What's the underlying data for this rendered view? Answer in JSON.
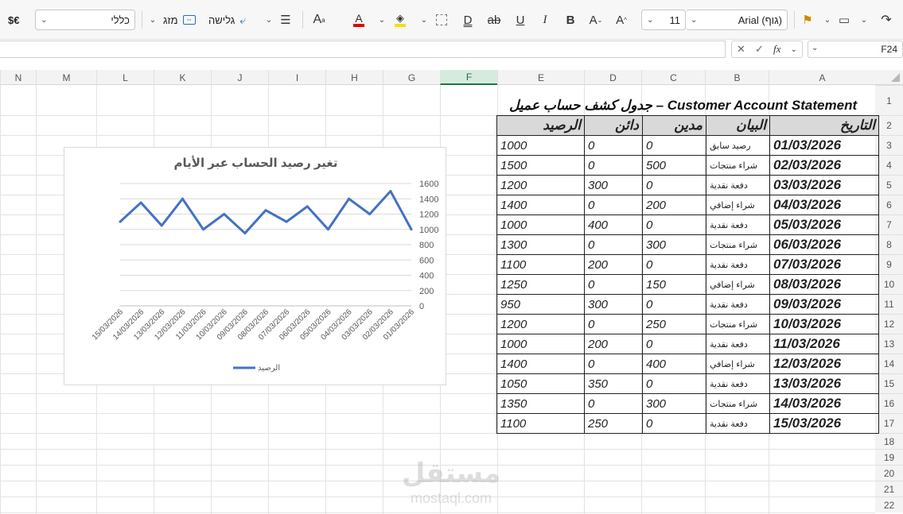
{
  "ribbon": {
    "currency_label": "$€",
    "number_format": "כללי",
    "merge_label": "מזג",
    "wrap_label": "גלישה",
    "font_size": "11",
    "font_name": "Arial (גוף)"
  },
  "formula_bar": {
    "name_box": "F24",
    "fx_label": "fx",
    "formula": ""
  },
  "columns": [
    "N",
    "M",
    "L",
    "K",
    "J",
    "I",
    "H",
    "G",
    "F",
    "E",
    "D",
    "C",
    "B",
    "A"
  ],
  "rows": [
    "1",
    "2",
    "3",
    "4",
    "5",
    "6",
    "7",
    "8",
    "9",
    "10",
    "11",
    "12",
    "13",
    "14",
    "15",
    "16",
    "17",
    "18",
    "19",
    "20",
    "21",
    "22"
  ],
  "sheet": {
    "title": "جدول كشف حساب عميل – Customer Account Statement",
    "headers": [
      "التاريخ",
      "البيان",
      "مدين",
      "دائن",
      "الرصيد"
    ],
    "rows": [
      {
        "date": "01/03/2026",
        "desc": "رصيد سابق",
        "debit": "0",
        "credit": "0",
        "balance": "1000"
      },
      {
        "date": "02/03/2026",
        "desc": "شراء منتجات",
        "debit": "500",
        "credit": "0",
        "balance": "1500"
      },
      {
        "date": "03/03/2026",
        "desc": "دفعة نقدية",
        "debit": "0",
        "credit": "300",
        "balance": "1200"
      },
      {
        "date": "04/03/2026",
        "desc": "شراء إضافي",
        "debit": "200",
        "credit": "0",
        "balance": "1400"
      },
      {
        "date": "05/03/2026",
        "desc": "دفعة نقدية",
        "debit": "0",
        "credit": "400",
        "balance": "1000"
      },
      {
        "date": "06/03/2026",
        "desc": "شراء منتجات",
        "debit": "300",
        "credit": "0",
        "balance": "1300"
      },
      {
        "date": "07/03/2026",
        "desc": "دفعة نقدية",
        "debit": "0",
        "credit": "200",
        "balance": "1100"
      },
      {
        "date": "08/03/2026",
        "desc": "شراء إضافي",
        "debit": "150",
        "credit": "0",
        "balance": "1250"
      },
      {
        "date": "09/03/2026",
        "desc": "دفعة نقدية",
        "debit": "0",
        "credit": "300",
        "balance": "950"
      },
      {
        "date": "10/03/2026",
        "desc": "شراء منتجات",
        "debit": "250",
        "credit": "0",
        "balance": "1200"
      },
      {
        "date": "11/03/2026",
        "desc": "دفعة نقدية",
        "debit": "0",
        "credit": "200",
        "balance": "1000"
      },
      {
        "date": "12/03/2026",
        "desc": "شراء إضافي",
        "debit": "400",
        "credit": "0",
        "balance": "1400"
      },
      {
        "date": "13/03/2026",
        "desc": "دفعة نقدية",
        "debit": "0",
        "credit": "350",
        "balance": "1050"
      },
      {
        "date": "14/03/2026",
        "desc": "شراء منتجات",
        "debit": "300",
        "credit": "0",
        "balance": "1350"
      },
      {
        "date": "15/03/2026",
        "desc": "دفعة نقدية",
        "debit": "0",
        "credit": "250",
        "balance": "1100"
      }
    ]
  },
  "chart_data": {
    "type": "line",
    "title": "تغير رصيد الحساب عبر الأيام",
    "categories": [
      "01/03/2026",
      "02/03/2026",
      "03/03/2026",
      "04/03/2026",
      "05/03/2026",
      "06/03/2026",
      "07/03/2026",
      "08/03/2026",
      "09/03/2026",
      "10/03/2026",
      "11/03/2026",
      "12/03/2026",
      "13/03/2026",
      "14/03/2026",
      "15/03/2026"
    ],
    "series": [
      {
        "name": "الرصيد",
        "values": [
          1000,
          1500,
          1200,
          1400,
          1000,
          1300,
          1100,
          1250,
          950,
          1200,
          1000,
          1400,
          1050,
          1350,
          1100
        ],
        "color": "#4472c4"
      }
    ],
    "x_reversed": true,
    "y_axis_side": "right",
    "ylim": [
      0,
      1600
    ],
    "yticks": [
      0,
      200,
      400,
      600,
      800,
      1000,
      1200,
      1400,
      1600
    ],
    "grid": true,
    "legend": "bottom"
  },
  "watermark": {
    "brand": "مستقل",
    "url": "mostaql.com"
  }
}
